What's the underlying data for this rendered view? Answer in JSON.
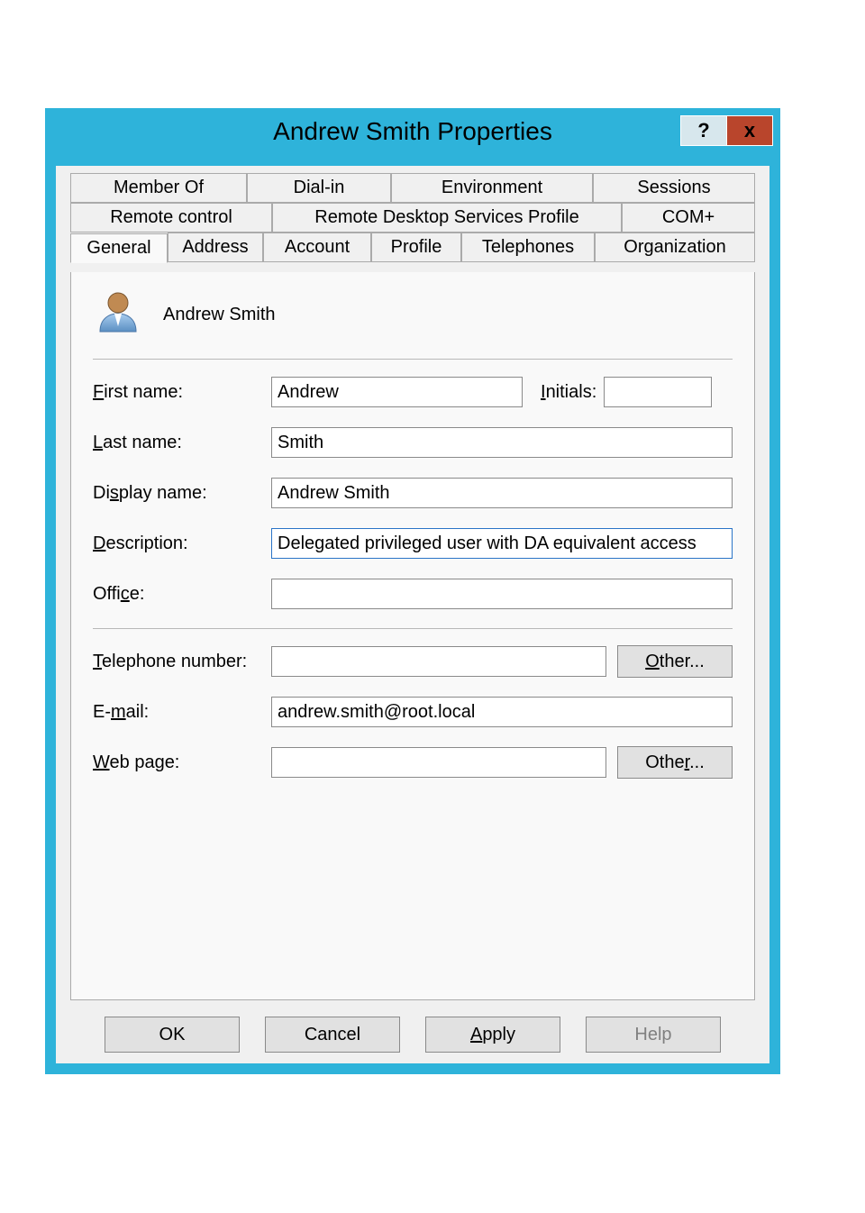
{
  "window": {
    "title": "Andrew Smith Properties",
    "help": "?",
    "close": "x"
  },
  "tabs": {
    "row1": [
      {
        "label": "Member Of"
      },
      {
        "label": "Dial-in"
      },
      {
        "label": "Environment"
      },
      {
        "label": "Sessions"
      }
    ],
    "row2": [
      {
        "label": "Remote control"
      },
      {
        "label": "Remote Desktop Services Profile"
      },
      {
        "label": "COM+"
      }
    ],
    "row3": [
      {
        "label": "General",
        "active": true
      },
      {
        "label": "Address"
      },
      {
        "label": "Account"
      },
      {
        "label": "Profile"
      },
      {
        "label": "Telephones"
      },
      {
        "label": "Organization"
      }
    ]
  },
  "user": {
    "display_name": "Andrew Smith"
  },
  "labels": {
    "first_name": "First name:",
    "initials": "Initials:",
    "last_name": "Last name:",
    "display_name": "Display name:",
    "description": "Description:",
    "office": "Office:",
    "telephone": "Telephone number:",
    "email": "E-mail:",
    "webpage": "Web page:",
    "other": "Other..."
  },
  "label_parts": {
    "first_name": {
      "u": "F",
      "rest": "irst name:"
    },
    "initials": {
      "u": "I",
      "rest": "nitials:"
    },
    "last_name": {
      "u": "L",
      "rest": "ast name:"
    },
    "display_name": {
      "pre": "Di",
      "u": "s",
      "post": "play name:"
    },
    "description": {
      "u": "D",
      "rest": "escription:"
    },
    "office": {
      "pre": "Offi",
      "u": "c",
      "post": "e:"
    },
    "telephone": {
      "u": "T",
      "rest": "elephone number:"
    },
    "email": {
      "pre": "E-",
      "u": "m",
      "post": "ail:"
    },
    "webpage": {
      "u": "W",
      "rest": "eb page:"
    },
    "other_tel": {
      "u": "O",
      "rest": "ther..."
    },
    "other_web": {
      "pre": "Othe",
      "u": "r",
      "post": "..."
    },
    "apply": {
      "u": "A",
      "rest": "pply"
    }
  },
  "values": {
    "first_name": "Andrew",
    "initials": "",
    "last_name": "Smith",
    "display_name": "Andrew Smith",
    "description": "Delegated privileged user with DA equivalent access",
    "office": "",
    "telephone": "",
    "email": "andrew.smith@root.local",
    "webpage": ""
  },
  "buttons": {
    "ok": "OK",
    "cancel": "Cancel",
    "apply": "Apply",
    "help": "Help"
  }
}
